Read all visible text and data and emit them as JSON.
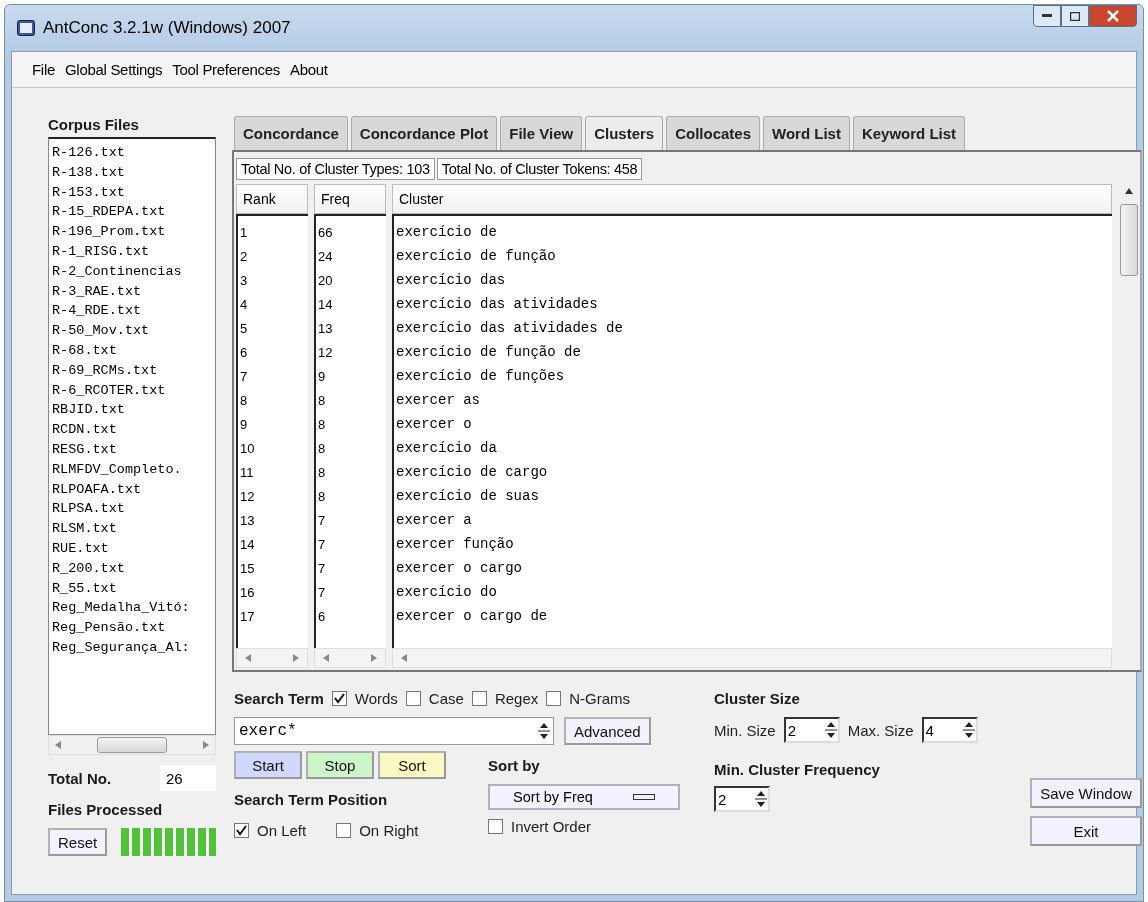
{
  "window": {
    "title": "AntConc 3.2.1w (Windows) 2007"
  },
  "menu": [
    "File",
    "Global Settings",
    "Tool Preferences",
    "About"
  ],
  "corpus": {
    "title": "Corpus Files",
    "files": [
      "R-126.txt",
      "R-138.txt",
      "R-153.txt",
      "R-15_RDEPA.txt",
      "R-196_Prom.txt",
      "R-1_RISG.txt",
      "R-2_Continencias",
      "R-3_RAE.txt",
      "R-4_RDE.txt",
      "R-50_Mov.txt",
      "R-68.txt",
      "R-69_RCMs.txt",
      "R-6_RCOTER.txt",
      "RBJID.txt",
      "RCDN.txt",
      "RESG.txt",
      "RLMFDV_Completo.",
      "RLPOAFA.txt",
      "RLPSA.txt",
      "RLSM.txt",
      "RUE.txt",
      "R_200.txt",
      "R_55.txt",
      "Reg_Medalha_Vitó:",
      "Reg_Pensão.txt",
      "Reg_Segurança_Al:"
    ]
  },
  "total_no": {
    "label": "Total No.",
    "value": "26"
  },
  "files_processed": {
    "label": "Files Processed",
    "level": 1
  },
  "reset_button": "Reset",
  "tabs": [
    {
      "label": "Concordance",
      "selected": false
    },
    {
      "label": "Concordance Plot",
      "selected": false
    },
    {
      "label": "File View",
      "selected": false
    },
    {
      "label": "Clusters",
      "selected": true
    },
    {
      "label": "Collocates",
      "selected": false
    },
    {
      "label": "Word List",
      "selected": false
    },
    {
      "label": "Keyword List",
      "selected": false
    }
  ],
  "stats": [
    "Total No. of Cluster Types: 103",
    "Total No. of Cluster Tokens: 458"
  ],
  "table": {
    "columns": [
      "Rank",
      "Freq",
      "Cluster"
    ],
    "rows": [
      [
        "1",
        "66",
        "exercício de"
      ],
      [
        "2",
        "24",
        "exercício de função"
      ],
      [
        "3",
        "20",
        "exercício das"
      ],
      [
        "4",
        "14",
        "exercício das atividades"
      ],
      [
        "5",
        "13",
        "exercício das atividades de"
      ],
      [
        "6",
        "12",
        "exercício de função de"
      ],
      [
        "7",
        "9",
        "exercício de funções"
      ],
      [
        "8",
        "8",
        "exercer as"
      ],
      [
        "9",
        "8",
        "exercer o"
      ],
      [
        "10",
        "8",
        "exercício da"
      ],
      [
        "11",
        "8",
        "exercício de cargo"
      ],
      [
        "12",
        "8",
        "exercício de suas"
      ],
      [
        "13",
        "7",
        "exercer a"
      ],
      [
        "14",
        "7",
        "exercer função"
      ],
      [
        "15",
        "7",
        "exercer o cargo"
      ],
      [
        "16",
        "7",
        "exercício do"
      ],
      [
        "17",
        "6",
        "exercer o cargo de"
      ]
    ]
  },
  "search": {
    "label": "Search Term",
    "options": [
      {
        "label": "Words",
        "checked": true
      },
      {
        "label": "Case",
        "checked": false
      },
      {
        "label": "Regex",
        "checked": false
      },
      {
        "label": "N-Grams",
        "checked": false
      }
    ],
    "value": "exerc*",
    "advanced": "Advanced"
  },
  "actions": [
    {
      "label": "Start",
      "kind": "start"
    },
    {
      "label": "Stop",
      "kind": "stop"
    },
    {
      "label": "Sort",
      "kind": "sort"
    }
  ],
  "position": {
    "label": "Search Term Position",
    "options": [
      {
        "label": "On Left",
        "checked": true
      },
      {
        "label": "On Right",
        "checked": false
      }
    ]
  },
  "sort_by": {
    "label": "Sort by",
    "value": "Sort by Freq",
    "invert": {
      "label": "Invert Order",
      "checked": false
    }
  },
  "cluster_size": {
    "label": "Cluster Size",
    "min_label": "Min. Size",
    "min_value": "2",
    "max_label": "Max. Size",
    "max_value": "4"
  },
  "min_freq": {
    "label": "Min. Cluster Frequency",
    "value": "2"
  },
  "save_button": "Save Window",
  "exit_button": "Exit"
}
